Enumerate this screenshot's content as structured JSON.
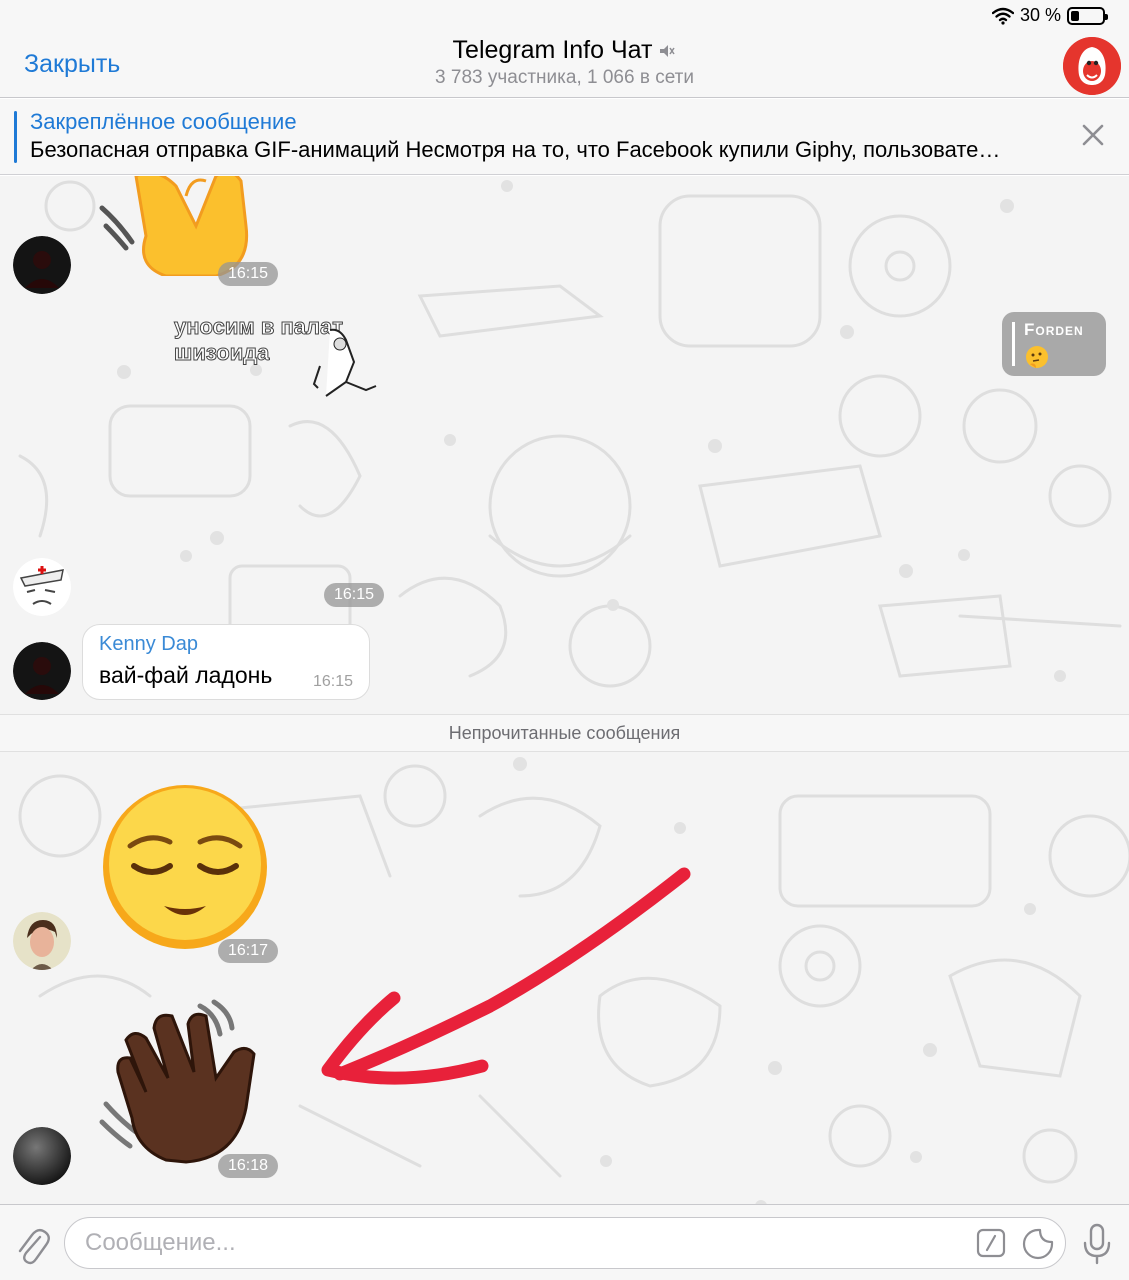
{
  "status_bar": {
    "battery_text": "30 %",
    "battery_level": 0.3
  },
  "header": {
    "close_label": "Закрыть",
    "title": "Telegram Info Чат",
    "subtitle": "3 783 участника, 1 066 в сети",
    "muted": true
  },
  "pinned": {
    "title": "Закреплённое сообщение",
    "text": "Безопасная отправка GIF-анимаций Несмотря на то, что Facebook купили Giphy, пользовате…"
  },
  "messages": {
    "sticker1_time": "16:15",
    "gif_caption_line1": "уносим в палат",
    "gif_caption_line2": "шизоида",
    "forden_name": "Forden",
    "gif_time": "16:15",
    "text_message": {
      "author": "Kenny Dap",
      "text": "вай-фай ладонь",
      "time": "16:15"
    },
    "unread_divider": "Непрочитанные сообщения",
    "sticker2_time": "16:17",
    "sticker3_time": "16:18"
  },
  "input": {
    "placeholder": "Сообщение..."
  },
  "colors": {
    "accent": "#1f7ad6",
    "avatar_red": "#e5352d",
    "arrow_red": "#e8213a"
  },
  "icons": [
    "wifi-icon",
    "battery-icon",
    "mute-icon",
    "close-x-icon",
    "attach-icon",
    "command-icon",
    "sticker-icon",
    "mic-icon"
  ]
}
